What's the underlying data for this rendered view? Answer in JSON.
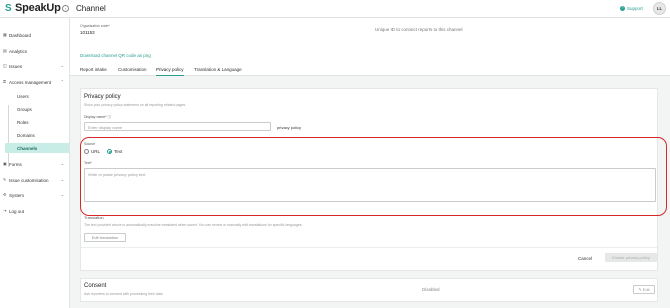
{
  "header": {
    "logo_text": "SpeakUp",
    "title": "Channel",
    "support_label": "Support",
    "avatar_initials": "LL"
  },
  "sidebar": {
    "items": [
      {
        "label": "Dashboard",
        "icon": "dashboard-icon"
      },
      {
        "label": "Analytics",
        "icon": "analytics-icon"
      },
      {
        "label": "Issues",
        "icon": "issues-icon"
      },
      {
        "label": "Access management",
        "icon": "access-icon"
      },
      {
        "label": "Forms",
        "icon": "forms-icon"
      },
      {
        "label": "Issue customisation",
        "icon": "customisation-icon"
      },
      {
        "label": "System",
        "icon": "system-icon"
      },
      {
        "label": "Log out",
        "icon": "logout-icon"
      }
    ],
    "sub_items": [
      "Users",
      "Groups",
      "Roles",
      "Domains",
      "Channels"
    ]
  },
  "org": {
    "label": "Organisation code*",
    "value": "101153",
    "hint": "Unique ID to connect reports to this channel",
    "download": "Download channel QR code as png"
  },
  "tabs": [
    "Report intake",
    "Customisation",
    "Privacy policy",
    "Translation & Language"
  ],
  "privacy": {
    "title": "Privacy policy",
    "description": "Show your privacy policy statement on all reporting related pages.",
    "display_name_label": "Display name* ⓘ",
    "display_name_placeholder": "Enter display name",
    "display_name_side": "privacy policy",
    "source_label": "Source",
    "source_url": "URL",
    "source_text": "Text",
    "text_label": "Text*",
    "text_placeholder": "Write or paste privacy policy text",
    "translation_label": "Translation",
    "translation_desc": "The text provided above is automatically machine translated when saved. You can review or manually edit translations for specific languages.",
    "edit_translation": "Edit translation",
    "cancel": "Cancel",
    "enable": "Enable privacy policy"
  },
  "consent": {
    "title": "Consent",
    "description": "Ask reporters to consent with processing their data",
    "status": "Disabled",
    "edit": "✎ Edit"
  },
  "colors": {
    "accent": "#2a9d8f",
    "highlight_ring": "#d62828",
    "active_sidebar_bg": "#c8ece6"
  }
}
